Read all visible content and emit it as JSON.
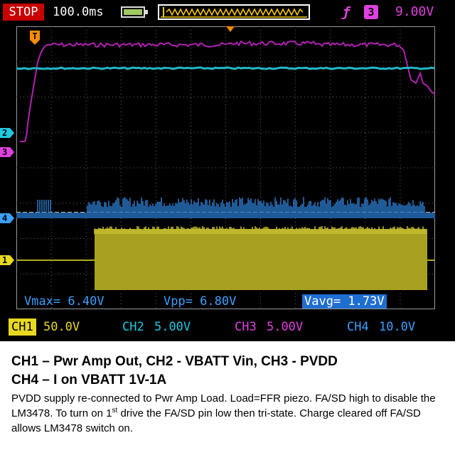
{
  "top_bar": {
    "run_state": "STOP",
    "timebase": "100.0ms",
    "trigger_edge_symbol": "ƒ",
    "trigger_source": "3",
    "trigger_level": "9.00V"
  },
  "channel_markers": [
    {
      "label": "2",
      "color": "#20c8e0"
    },
    {
      "label": "3",
      "color": "#e040e0"
    },
    {
      "label": "4",
      "color": "#3aa0ff"
    },
    {
      "label": "1",
      "color": "#e8d820"
    }
  ],
  "trigger_marker": {
    "label": "T",
    "color": "#ff8c00"
  },
  "measurements": {
    "vmax": "Vmax= 6.40V",
    "vpp": "Vpp= 6.80V",
    "vavg": "Vavg= 1.73V"
  },
  "channels": [
    {
      "label": "CH1",
      "scale": "50.0V",
      "color": "#e8d820"
    },
    {
      "label": "CH2",
      "scale": "5.00V",
      "color": "#20c8e0"
    },
    {
      "label": "CH3",
      "scale": "5.00V",
      "color": "#e040e0"
    },
    {
      "label": "CH4",
      "scale": "10.0V",
      "color": "#3aa0ff"
    }
  ],
  "caption": {
    "heading_line1": "CH1 – Pwr Amp Out, CH2 - VBATT Vin, CH3 - PVDD",
    "heading_line2": "CH4 – I on VBATT 1V-1A",
    "body_part1": "PVDD supply re-connected to Pwr Amp Load. Load=FFR piezo. FA/SD high to disable the LM3478. To turn on 1",
    "body_sup": "st",
    "body_part2": " drive the FA/SD pin low then tri-state. Charge cleared off FA/SD allows LM3478 switch on."
  }
}
